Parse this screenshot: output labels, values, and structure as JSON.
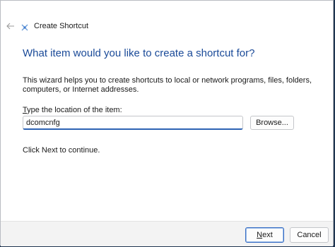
{
  "window": {
    "title": "Create Shortcut"
  },
  "icons": {
    "back": "back-arrow-icon",
    "app": "shortcut-wizard-icon"
  },
  "colors": {
    "heading": "#1a4a98",
    "accent": "#2c62b4"
  },
  "main": {
    "heading": "What item would you like to create a shortcut for?",
    "description": "This wizard helps you to create shortcuts to local or network programs, files, folders, computers, or Internet addresses.",
    "location_label_mnemonic": "T",
    "location_label_rest": "ype the location of the item:",
    "location_value": "dcomcnfg",
    "browse_label": "Browse...",
    "continue_text": "Click Next to continue."
  },
  "footer": {
    "next_mnemonic": "N",
    "next_rest": "ext",
    "cancel_label": "Cancel"
  }
}
